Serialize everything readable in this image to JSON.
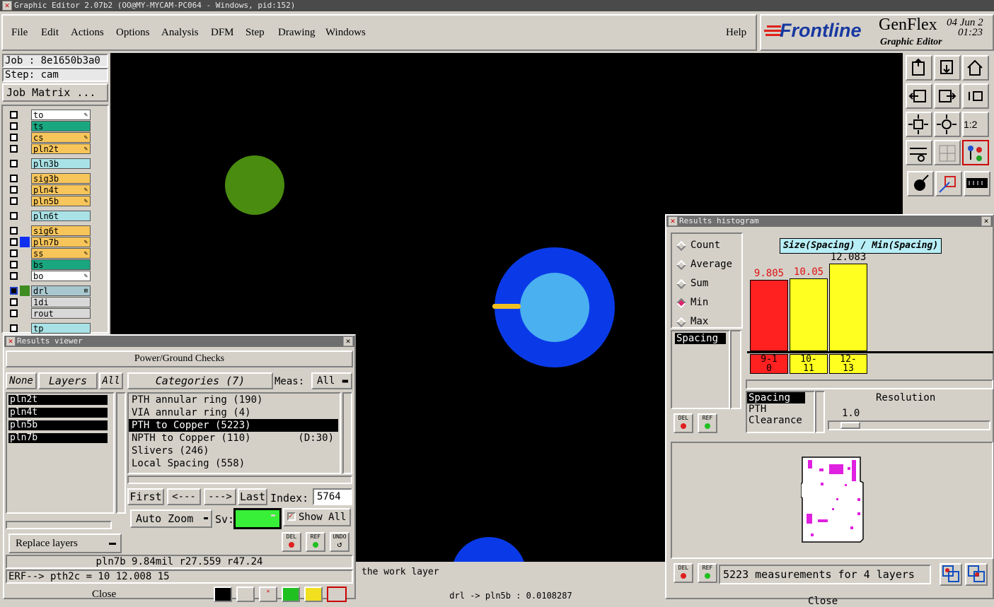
{
  "window_title": "Graphic Editor 2.07b2 (OO@MY-MYCAM-PC064 - Windows, pid:152)",
  "menu": {
    "file": "File",
    "edit": "Edit",
    "actions": "Actions",
    "options": "Options",
    "analysis": "Analysis",
    "dfm": "DFM",
    "step": "Step",
    "drawing": "Drawing",
    "windows": "Windows",
    "help": "Help"
  },
  "brand": {
    "frontline": "Frontline",
    "genflex": "GenFlex",
    "subtitle": "Graphic Editor",
    "date": "04 Jun 2",
    "time": "01:23"
  },
  "job": {
    "job_label": "Job : 8e1650b3a0",
    "step_label": "Step: cam",
    "matrix_button": "Job Matrix ..."
  },
  "layers": [
    {
      "name": "to",
      "color": "#ffffff",
      "mark": "✎"
    },
    {
      "name": "ts",
      "color": "#1aa780",
      "mark": ""
    },
    {
      "name": "cs",
      "color": "#f7c55a",
      "mark": "✎"
    },
    {
      "name": "pln2t",
      "color": "#f7c55a",
      "mark": "✎"
    },
    {
      "name": "pln3b",
      "color": "#a9e2e6",
      "mark": ""
    },
    {
      "name": "sig3b",
      "color": "#f7c55a",
      "mark": ""
    },
    {
      "name": "pln4t",
      "color": "#f7c55a",
      "mark": "✎"
    },
    {
      "name": "pln5b",
      "color": "#f7c55a",
      "mark": "✎"
    },
    {
      "name": "pln6t",
      "color": "#a9e2e6",
      "mark": ""
    },
    {
      "name": "sig6t",
      "color": "#f7c55a",
      "mark": ""
    },
    {
      "name": "pln7b",
      "color": "#f7c55a",
      "mark": "✎"
    },
    {
      "name": "ss",
      "color": "#f7c55a",
      "mark": "✎"
    },
    {
      "name": "bs",
      "color": "#1aa780",
      "mark": ""
    },
    {
      "name": "bo",
      "color": "#ffffff",
      "mark": "✎"
    },
    {
      "name": "drl",
      "color": "#a9c7cf",
      "mark": "⊞"
    },
    {
      "name": "1di",
      "color": "#d8d8d8",
      "mark": ""
    },
    {
      "name": "rout",
      "color": "#d8d8d8",
      "mark": ""
    },
    {
      "name": "tp",
      "color": "#a9e2e6",
      "mark": ""
    }
  ],
  "results_viewer": {
    "title": "Results viewer",
    "header": "Power/Ground Checks",
    "none_btn": "None",
    "layers_btn": "Layers",
    "all_btn": "All",
    "layer_list": [
      "pln2t",
      "pln4t",
      "pln5b",
      "pln7b"
    ],
    "categories_btn": "Categories (7)",
    "meas_label": "Meas:",
    "meas_value": "All",
    "categories": [
      {
        "text": "PTH annular ring (190)",
        "extra": ""
      },
      {
        "text": "VIA annular ring (4)",
        "extra": ""
      },
      {
        "text": "PTH to Copper (5223)",
        "extra": ""
      },
      {
        "text": "NPTH to Copper (110)",
        "extra": "(D:30)"
      },
      {
        "text": "Slivers (246)",
        "extra": ""
      },
      {
        "text": "Local Spacing (558)",
        "extra": ""
      }
    ],
    "first": "First",
    "prev": "<---",
    "next": "--->",
    "last": "Last",
    "index_label": "Index:",
    "index_value": "5764",
    "auto_zoom": "Auto Zoom",
    "sv_label": "Sv:",
    "show_all": "Show All",
    "replace_layers": "Replace layers",
    "del": "DEL",
    "ref": "REF",
    "undo": "UNDO",
    "info_line": "pln7b 9.84mil   r27.559  r47.24",
    "erf_line": "ERF--> pth2c = 10 12.008 15",
    "close": "Close"
  },
  "status": {
    "work_layer": "the work layer",
    "drl_line": "drl -> pln5b : 0.0108287"
  },
  "histogram": {
    "title": "Results histogram",
    "modes": [
      "Count",
      "Average",
      "Sum",
      "Min",
      "Max"
    ],
    "selected_mode": "Min",
    "attr_list": [
      "Spacing"
    ],
    "chart_title": "Size(Spacing) / Min(Spacing)",
    "field_list": [
      "Spacing",
      "PTH",
      "Clearance"
    ],
    "resolution_label": "Resolution",
    "resolution_value": "1.0",
    "summary": "5223 measurements for 4 layers",
    "close": "Close"
  },
  "chart_data": {
    "type": "bar",
    "title": "Size(Spacing) / Min(Spacing)",
    "categories": [
      "9-10",
      "10-11",
      "12-13"
    ],
    "values": [
      9.805,
      10.05,
      12.083
    ],
    "value_labels": [
      "9.805",
      "10.05",
      "12.083"
    ],
    "colors": [
      "#ff2020",
      "#ffff20",
      "#ffff20"
    ],
    "ylim": [
      0,
      12.083
    ]
  }
}
